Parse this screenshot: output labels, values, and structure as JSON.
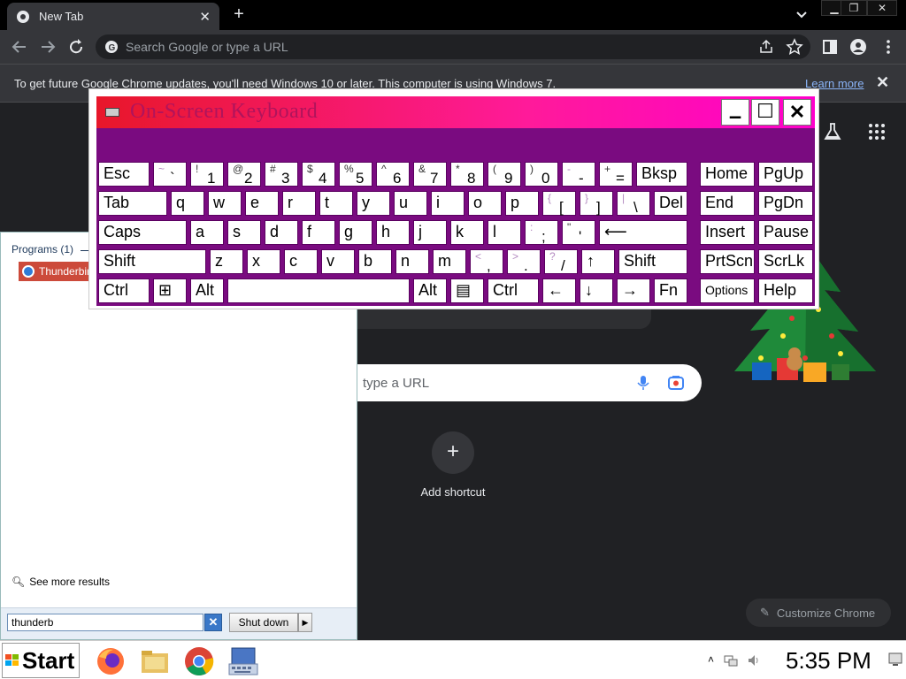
{
  "browser": {
    "tab_title": "New Tab",
    "tab_close": "✕",
    "new_tab": "+",
    "omnibox_placeholder": "Search Google or type a URL",
    "infobar_message": "To get future Google Chrome updates, you'll need Windows 10 or later. This computer is using Windows 7.",
    "infobar_link": "Learn more",
    "infobar_close": "✕",
    "window_controls": [
      "▁",
      "❐",
      "✕"
    ]
  },
  "ntp": {
    "search_placeholder": "type a URL",
    "add_shortcut_label": "Add shortcut",
    "add_shortcut_icon": "+",
    "customize_label": "Customize Chrome"
  },
  "start_menu": {
    "programs_header": "Programs (1)",
    "result_label": "Thunderbird",
    "see_more": "See more results",
    "search_value": "thunderb",
    "clear_label": "✕",
    "shutdown_label": "Shut down",
    "shutdown_arrow": "▶"
  },
  "osk": {
    "title": "On-Screen Keyboard",
    "minimize": "▁",
    "maximize": "☐",
    "close": "✕",
    "rows": [
      [
        {
          "main": "Esc",
          "w": 58
        },
        {
          "shift": "~",
          "lower": "`",
          "w": 38,
          "sym": true
        },
        {
          "shift": "!",
          "lower": "1",
          "w": 38
        },
        {
          "shift": "@",
          "lower": "2",
          "w": 38
        },
        {
          "shift": "#",
          "lower": "3",
          "w": 38
        },
        {
          "shift": "$",
          "lower": "4",
          "w": 38
        },
        {
          "shift": "%",
          "lower": "5",
          "w": 38
        },
        {
          "shift": "^",
          "lower": "6",
          "w": 38
        },
        {
          "shift": "&",
          "lower": "7",
          "w": 38
        },
        {
          "shift": "*",
          "lower": "8",
          "w": 38
        },
        {
          "shift": "(",
          "lower": "9",
          "w": 38
        },
        {
          "shift": ")",
          "lower": "0",
          "w": 38
        },
        {
          "shift": "-",
          "lower": "-",
          "w": 38,
          "sym": true
        },
        {
          "shift": "+",
          "lower": "=",
          "w": 38
        },
        {
          "main": "Bksp",
          "w": 58
        },
        {
          "main": "Home",
          "w": 62,
          "gap": 10
        },
        {
          "main": "PgUp",
          "w": 62
        }
      ],
      [
        {
          "main": "Tab",
          "w": 78
        },
        {
          "main": "q",
          "w": 38
        },
        {
          "main": "w",
          "w": 38
        },
        {
          "main": "e",
          "w": 38
        },
        {
          "main": "r",
          "w": 38
        },
        {
          "main": "t",
          "w": 38
        },
        {
          "main": "y",
          "w": 38
        },
        {
          "main": "u",
          "w": 38
        },
        {
          "main": "i",
          "w": 38
        },
        {
          "main": "o",
          "w": 38
        },
        {
          "main": "p",
          "w": 38
        },
        {
          "shift": "{",
          "lower": "[",
          "w": 38,
          "sym": true
        },
        {
          "shift": "}",
          "lower": "]",
          "w": 38,
          "sym": true
        },
        {
          "shift": "|",
          "lower": "\\",
          "w": 38,
          "sym": true
        },
        {
          "main": "Del",
          "w": 38
        },
        {
          "main": "End",
          "w": 62,
          "gap": 10
        },
        {
          "main": "PgDn",
          "w": 62
        }
      ],
      [
        {
          "main": "Caps",
          "w": 100
        },
        {
          "main": "a",
          "w": 38
        },
        {
          "main": "s",
          "w": 38
        },
        {
          "main": "d",
          "w": 38
        },
        {
          "main": "f",
          "w": 38
        },
        {
          "main": "g",
          "w": 38
        },
        {
          "main": "h",
          "w": 38
        },
        {
          "main": "j",
          "w": 38
        },
        {
          "main": "k",
          "w": 38
        },
        {
          "main": "l",
          "w": 38
        },
        {
          "shift": ":",
          "lower": ";",
          "w": 38,
          "sym": true
        },
        {
          "shift": "\"",
          "lower": "'",
          "w": 38
        },
        {
          "main": "⟵",
          "w": 100
        },
        {
          "main": "Insert",
          "w": 62,
          "gap": 10
        },
        {
          "main": "Pause",
          "w": 62
        }
      ],
      [
        {
          "main": "Shift",
          "w": 122
        },
        {
          "main": "z",
          "w": 38
        },
        {
          "main": "x",
          "w": 38
        },
        {
          "main": "c",
          "w": 38
        },
        {
          "main": "v",
          "w": 38
        },
        {
          "main": "b",
          "w": 38
        },
        {
          "main": "n",
          "w": 38
        },
        {
          "main": "m",
          "w": 38
        },
        {
          "shift": "<",
          "lower": ",",
          "w": 38,
          "sym": true
        },
        {
          "shift": ">",
          "lower": ".",
          "w": 38,
          "sym": true
        },
        {
          "shift": "?",
          "lower": "/",
          "w": 38,
          "sym": true
        },
        {
          "main": "↑",
          "w": 38
        },
        {
          "main": "Shift",
          "w": 78
        },
        {
          "main": "PrtScn",
          "w": 62,
          "gap": 10
        },
        {
          "main": "ScrLk",
          "w": 62
        }
      ],
      [
        {
          "main": "Ctrl",
          "w": 58
        },
        {
          "main": "⊞",
          "w": 38
        },
        {
          "main": "Alt",
          "w": 38
        },
        {
          "main": "",
          "w": 206
        },
        {
          "main": "Alt",
          "w": 38
        },
        {
          "main": "▤",
          "w": 38
        },
        {
          "main": "Ctrl",
          "w": 58
        },
        {
          "main": "←",
          "w": 38
        },
        {
          "main": "↓",
          "w": 38
        },
        {
          "main": "→",
          "w": 38
        },
        {
          "main": "Fn",
          "w": 38
        },
        {
          "main": "Options",
          "w": 62,
          "gap": 10,
          "small": true
        },
        {
          "main": "Help",
          "w": 62
        }
      ]
    ]
  },
  "taskbar": {
    "start_label": "Start",
    "tray_arrow": "˄",
    "clock": "5:35 PM"
  },
  "colors": {
    "osk_purple": "#7a0b80",
    "chrome_dark": "#202124",
    "start_result": "#cc4a3a"
  }
}
